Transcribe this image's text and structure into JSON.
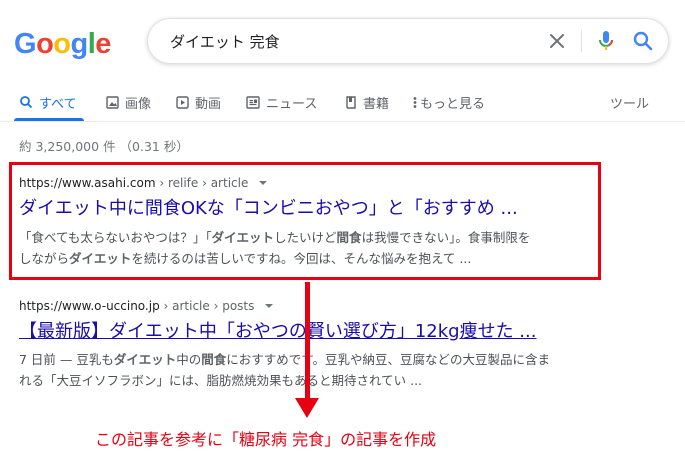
{
  "logo": {
    "letters": [
      "G",
      "o",
      "o",
      "g",
      "l",
      "e"
    ],
    "colors": [
      "#4285f4",
      "#ea4335",
      "#fbbc05",
      "#4285f4",
      "#34a853",
      "#ea4335"
    ]
  },
  "search": {
    "query": "ダイエット 完食"
  },
  "tabs": [
    {
      "label": "すべて",
      "icon": "search-icon",
      "active": true
    },
    {
      "label": "画像",
      "icon": "image-icon"
    },
    {
      "label": "動画",
      "icon": "video-icon"
    },
    {
      "label": "ニュース",
      "icon": "news-icon"
    },
    {
      "label": "書籍",
      "icon": "book-icon"
    },
    {
      "label": "もっと見る",
      "icon": "more-vert-icon"
    }
  ],
  "tools_label": "ツール",
  "stats": "約 3,250,000 件 （0.31 秒）",
  "results": [
    {
      "cite_domain": "https://www.asahi.com",
      "cite_path": " › relife › article",
      "title": "ダイエット中に間食OKな「コンビニおやつ」と「おすすめ ...",
      "snippet_line1": [
        "「食べても太らないおやつは？」「",
        "ダイエット",
        "したいけど",
        "間食",
        "は我慢できない」。食事制限を"
      ],
      "snippet_line2": [
        "しながら",
        "ダイエット",
        "を続けるのは苦しいですね。今回は、そんな悩みを抱えて ..."
      ]
    },
    {
      "cite_domain": "https://www.o-uccino.jp",
      "cite_path": " › article › posts",
      "title": "【最新版】ダイエット中「おやつの賢い選び方」12kg痩せた ...",
      "snippet_line1": [
        "7 日前 — 豆乳も",
        "ダイエット",
        "中の",
        "間食",
        "におすすめです。豆乳や納豆、豆腐などの大豆製品に含ま"
      ],
      "snippet_line2": [
        "れる「大豆イソフラボン」には、脂肪燃焼効果もあると期待されてい ..."
      ]
    }
  ],
  "accent_color": "#e60012",
  "annotation": "この記事を参考に「糖尿病 完食」の記事を作成"
}
